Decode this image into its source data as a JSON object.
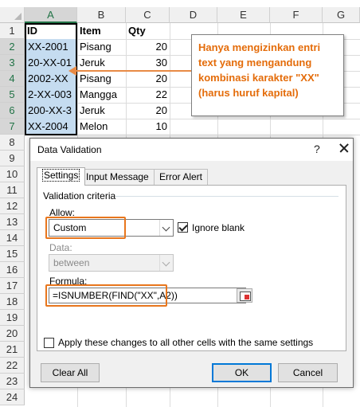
{
  "columns": [
    "A",
    "B",
    "C",
    "D",
    "E",
    "F",
    "G"
  ],
  "rows": [
    "1",
    "2",
    "3",
    "4",
    "5",
    "6",
    "7",
    "8",
    "9",
    "10",
    "11",
    "12",
    "13",
    "14",
    "15",
    "16",
    "17",
    "18",
    "19",
    "20",
    "21",
    "22",
    "23",
    "24"
  ],
  "table": {
    "headers": [
      "ID",
      "Item",
      "Qty"
    ],
    "data": [
      [
        "XX-2001",
        "Pisang",
        "20"
      ],
      [
        "20-XX-01",
        "Jeruk",
        "30"
      ],
      [
        "2002-XX",
        "Pisang",
        "20"
      ],
      [
        "2-XX-003",
        "Mangga",
        "22"
      ],
      [
        "200-XX-3",
        "Jeruk",
        "20"
      ],
      [
        "XX-2004",
        "Melon",
        "10"
      ]
    ]
  },
  "callout": {
    "line1": "Hanya mengizinkan entri",
    "line2": "text yang mengandung",
    "line3": "kombinasi karakter \"XX\"",
    "line4": "(harus huruf kapital)"
  },
  "dialog": {
    "title": "Data Validation",
    "help": "?",
    "tabs": [
      "Settings",
      "Input Message",
      "Error Alert"
    ],
    "group_label": "Validation criteria",
    "allow_label": "Allow:",
    "allow_value": "Custom",
    "ignore_blank": "Ignore blank",
    "data_label": "Data:",
    "data_value": "between",
    "formula_label": "Formula:",
    "formula_value": "=ISNUMBER(FIND(\"XX\",A2))",
    "apply_all": "Apply these changes to all other cells with the same settings",
    "clear_all": "Clear All",
    "ok": "OK",
    "cancel": "Cancel"
  },
  "colors": {
    "accent_orange": "#e8761d",
    "callout_text": "#e46c0a",
    "selection": "#c5dcf0",
    "excel_green": "#217346"
  }
}
